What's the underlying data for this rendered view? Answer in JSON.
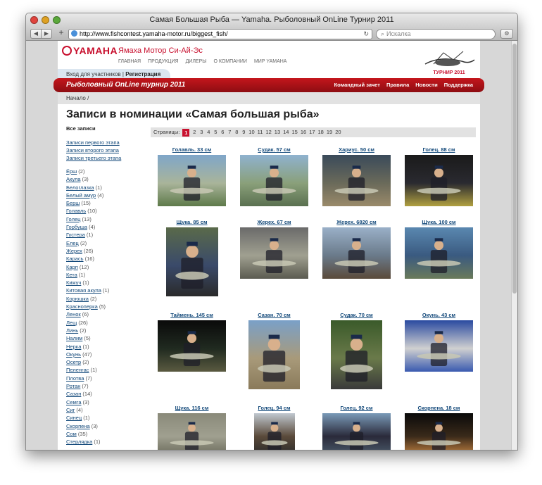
{
  "window": {
    "title": "Самая Большая Рыба — Yamaha. Рыболовный OnLine Турнир 2011"
  },
  "toolbar": {
    "url": "http://www.fishcontest.yamaha-motor.ru/biggest_fish/",
    "search_placeholder": "Искалка"
  },
  "header": {
    "logo": "YAMAHA",
    "brand": "Ямаха Мотор Си-Ай-Эс",
    "nav": [
      "ГЛАВНАЯ",
      "ПРОДУКЦИЯ",
      "ДИЛЕРЫ",
      "О КОМПАНИИ",
      "МИР YAMAHA"
    ]
  },
  "login": {
    "enter": "Вход для участников",
    "sep": "|",
    "register": "Регистрация"
  },
  "redbar": {
    "title": "Рыболовный OnLine турнир 2011",
    "nav": [
      "Командный зачет",
      "Правила",
      "Новости",
      "Поддержка"
    ]
  },
  "breadcrumb": "Начало /",
  "heading": "Записи в номинации «Самая большая рыба»",
  "sidebar": {
    "all": "Все записи",
    "stages": [
      "Записи первого этапа",
      "Записи второго этапа",
      "Записи третьего этапа"
    ],
    "fish": [
      {
        "name": "Ёрш",
        "count": "(2)"
      },
      {
        "name": "Акула",
        "count": "(3)"
      },
      {
        "name": "Белоглазка",
        "count": "(1)"
      },
      {
        "name": "Белый амур",
        "count": "(4)"
      },
      {
        "name": "Берш",
        "count": "(15)"
      },
      {
        "name": "Голавль",
        "count": "(10)"
      },
      {
        "name": "Голец",
        "count": "(13)"
      },
      {
        "name": "Горбуша",
        "count": "(4)"
      },
      {
        "name": "Густера",
        "count": "(1)"
      },
      {
        "name": "Елец",
        "count": "(2)"
      },
      {
        "name": "Жерех",
        "count": "(26)"
      },
      {
        "name": "Карась",
        "count": "(16)"
      },
      {
        "name": "Карп",
        "count": "(12)"
      },
      {
        "name": "Кета",
        "count": "(1)"
      },
      {
        "name": "Кижуч",
        "count": "(1)"
      },
      {
        "name": "Китовая акула",
        "count": "(1)"
      },
      {
        "name": "Корюшка",
        "count": "(2)"
      },
      {
        "name": "Красноперка",
        "count": "(5)"
      },
      {
        "name": "Ленок",
        "count": "(6)"
      },
      {
        "name": "Лещ",
        "count": "(26)"
      },
      {
        "name": "Линь",
        "count": "(2)"
      },
      {
        "name": "Налим",
        "count": "(5)"
      },
      {
        "name": "Нерка",
        "count": "(1)"
      },
      {
        "name": "Окунь",
        "count": "(47)"
      },
      {
        "name": "Осетр",
        "count": "(2)"
      },
      {
        "name": "Пеленгас",
        "count": "(1)"
      },
      {
        "name": "Плотва",
        "count": "(7)"
      },
      {
        "name": "Ротан",
        "count": "(7)"
      },
      {
        "name": "Сазан",
        "count": "(14)"
      },
      {
        "name": "Семга",
        "count": "(3)"
      },
      {
        "name": "Сиг",
        "count": "(4)"
      },
      {
        "name": "Синец",
        "count": "(1)"
      },
      {
        "name": "Скорпена",
        "count": "(3)"
      },
      {
        "name": "Сом",
        "count": "(35)"
      },
      {
        "name": "Стерлядка",
        "count": "(1)"
      }
    ]
  },
  "pager": {
    "label": "Страницы:",
    "pages": [
      "1",
      "2",
      "3",
      "4",
      "5",
      "6",
      "7",
      "8",
      "9",
      "10",
      "11",
      "12",
      "13",
      "14",
      "15",
      "16",
      "17",
      "18",
      "19",
      "20"
    ],
    "current": "1"
  },
  "entries": [
    {
      "caption": "Голавль. 33 см",
      "colors": [
        "#7fa6c9",
        "#a9b49a",
        "#5e7a4a"
      ]
    },
    {
      "caption": "Судак. 57 см",
      "colors": [
        "#8fb2cf",
        "#8aa07a",
        "#5a7050"
      ]
    },
    {
      "caption": "Хариус. 50 см",
      "colors": [
        "#3a4a5a",
        "#6a6a5a",
        "#9a8a6a"
      ]
    },
    {
      "caption": "Голец. 88 см",
      "colors": [
        "#1a1a1a",
        "#2a2a30",
        "#b0a040"
      ]
    },
    {
      "caption": "Щука. 85 см",
      "colors": [
        "#5a6a4a",
        "#3a4a6a",
        "#2a2a2a"
      ]
    },
    {
      "caption": "Жерех. 67 см",
      "colors": [
        "#6a6a6a",
        "#a0a090",
        "#5a5a50"
      ]
    },
    {
      "caption": "Жерех. 6820 см",
      "colors": [
        "#9ab0c8",
        "#6a7a8a",
        "#5a4a3a"
      ]
    },
    {
      "caption": "Щука. 100 см",
      "colors": [
        "#5a88b0",
        "#3a5a80",
        "#6a7a5a"
      ]
    },
    {
      "caption": "Таймень. 145 см",
      "colors": [
        "#0a0a0a",
        "#202a20",
        "#5a5a40"
      ]
    },
    {
      "caption": "Сазан. 70 см",
      "colors": [
        "#7aa0c8",
        "#a89a7a",
        "#8a7a5a"
      ]
    },
    {
      "caption": "Судак. 70 см",
      "colors": [
        "#3a5a2a",
        "#6a7a4a",
        "#3a3a3a"
      ]
    },
    {
      "caption": "Окунь. 43 см",
      "colors": [
        "#2a4aa0",
        "#d0d0d0",
        "#3a5ab0"
      ]
    },
    {
      "caption": "Щука. 116 см",
      "colors": [
        "#8a8a7a",
        "#a0a090",
        "#6a6a5a"
      ]
    },
    {
      "caption": "Голец. 94 см",
      "colors": [
        "#c0c8d0",
        "#5a4a3a",
        "#2a2a2a"
      ]
    },
    {
      "caption": "Голец. 92 см",
      "colors": [
        "#7a9ab8",
        "#2a2a3a",
        "#4a5a6a"
      ]
    },
    {
      "caption": "Скорпена. 18 см",
      "colors": [
        "#0a0a0a",
        "#3a2a1a",
        "#c08040"
      ]
    }
  ]
}
